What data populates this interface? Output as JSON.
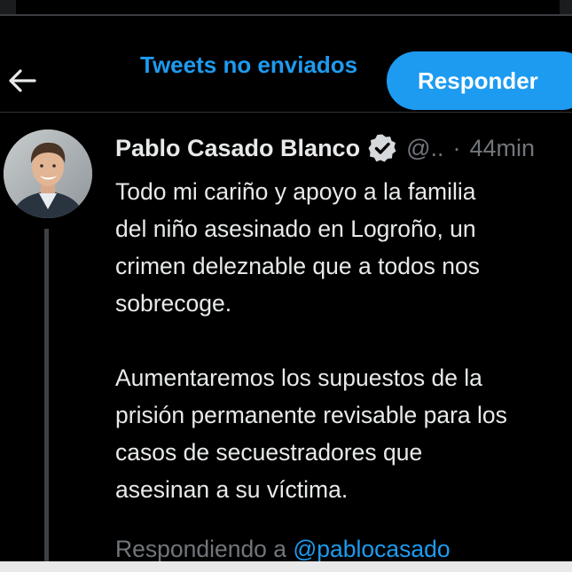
{
  "header": {
    "back_icon": "arrow-left-icon",
    "unsent_tweets_label": "Tweets no enviados",
    "reply_button_label": "Responder",
    "accent_color": "#1d9bf0"
  },
  "tweet": {
    "author_name": "Pablo Casado Blanco",
    "verified_icon": "verified-badge-icon",
    "handle": "@..",
    "separator": "·",
    "time": "44min",
    "lines": [
      "Todo mi cariño y apoyo a la familia",
      "del niño asesinado en Logroño, un",
      "crimen deleznable que a todos nos",
      "sobrecoge.",
      "",
      "Aumentaremos los supuestos de la",
      "prisión permanente revisable para los",
      "casos de secuestradores que",
      "asesinan a su víctima."
    ],
    "replying_prefix": "Respondiendo a",
    "replying_mention": "@pablocasado"
  }
}
